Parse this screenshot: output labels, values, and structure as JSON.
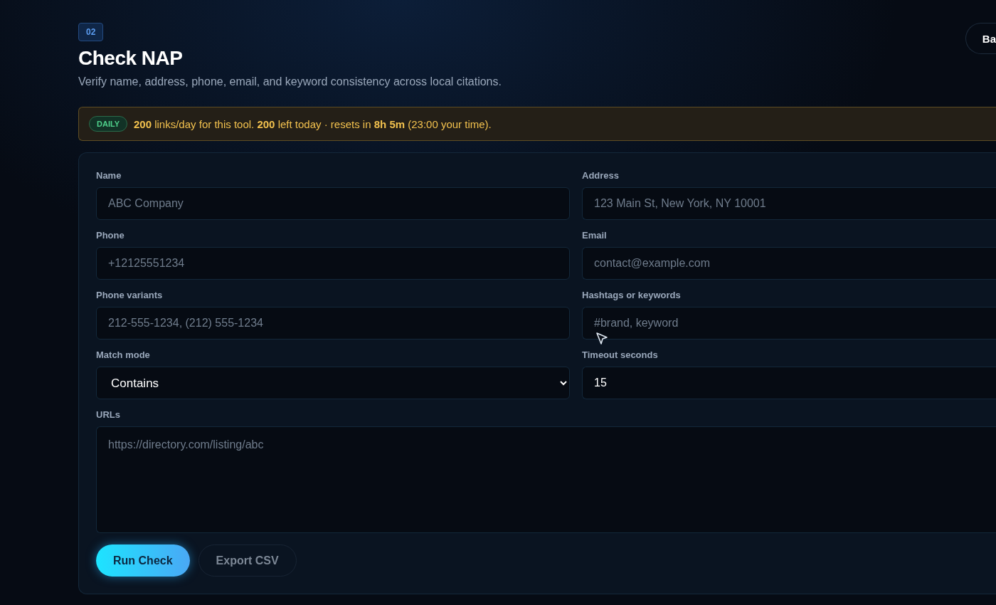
{
  "header": {
    "step": "02",
    "title": "Check NAP",
    "subtitle": "Verify name, address, phone, email, and keyword consistency across local citations.",
    "back_button": "Ba"
  },
  "quota": {
    "badge": "DAILY",
    "message": "**200** links/day for this tool. **200** left today · resets in **8h 5m** (23:00 your time)."
  },
  "form": {
    "fields": [
      {
        "kind": "input",
        "label": "Name",
        "placeholder": "ABC Company"
      },
      {
        "kind": "input",
        "label": "Address",
        "placeholder": "123 Main St, New York, NY 10001"
      },
      {
        "kind": "input",
        "label": "Phone",
        "placeholder": "+12125551234"
      },
      {
        "kind": "input",
        "label": "Email",
        "placeholder": "contact@example.com"
      },
      {
        "kind": "input",
        "label": "Phone variants",
        "placeholder": "212-555-1234, (212) 555-1234"
      },
      {
        "kind": "input",
        "label": "Hashtags or keywords",
        "placeholder": "#brand, keyword"
      },
      {
        "kind": "select",
        "label": "Match mode",
        "value": "Contains"
      },
      {
        "kind": "input",
        "label": "Timeout seconds",
        "value": "15"
      },
      {
        "kind": "textarea",
        "label": "URLs",
        "placeholder": "https://directory.com/listing/abc"
      }
    ],
    "buttons": [
      {
        "label": "Run Check",
        "kind": "primary"
      },
      {
        "label": "Export CSV",
        "kind": "secondary"
      }
    ]
  }
}
